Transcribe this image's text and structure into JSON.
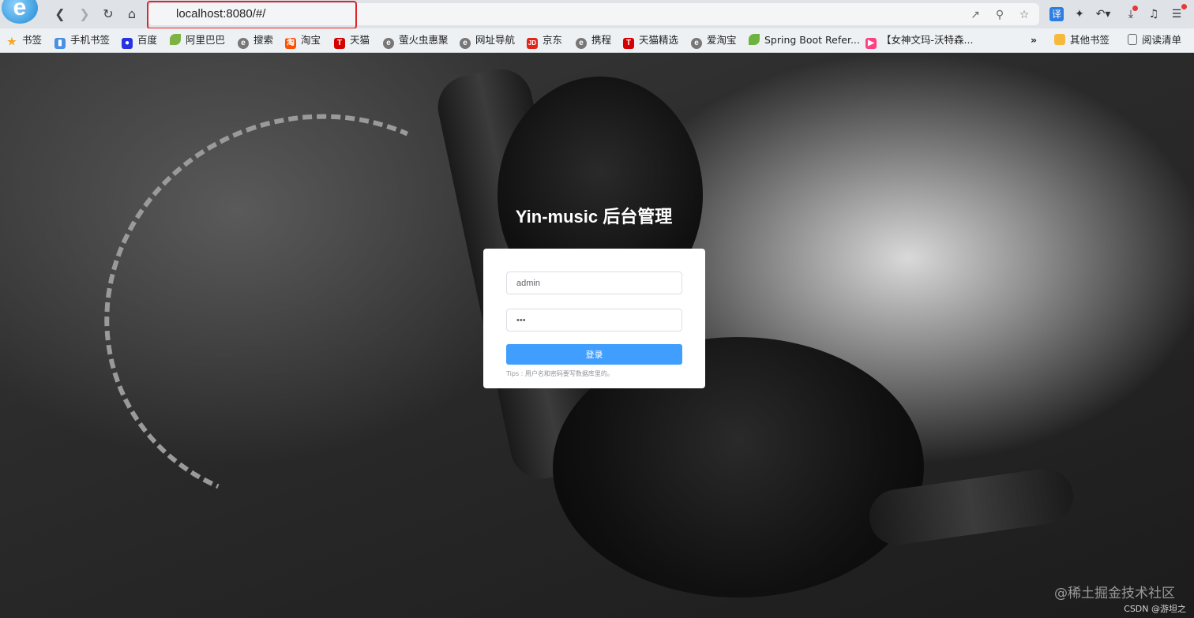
{
  "browser": {
    "address": "localhost:8080/#/",
    "translate_label": "译",
    "bookmarks": [
      {
        "label": "书签",
        "icon": "star-icon",
        "color": "#f5a623"
      },
      {
        "label": "手机书签",
        "icon": "phone-icon",
        "color": "#4a90e2"
      },
      {
        "label": "百度",
        "icon": "baidu-icon",
        "color": "#2932e1"
      },
      {
        "label": "阿里巴巴",
        "icon": "leaf-icon",
        "color": "#7cb342"
      },
      {
        "label": "搜索",
        "icon": "e-icon",
        "color": "#666666"
      },
      {
        "label": "淘宝",
        "icon": "taobao-icon",
        "color": "#ff5000"
      },
      {
        "label": "天猫",
        "icon": "tmall-icon",
        "color": "#d50000"
      },
      {
        "label": "萤火虫惠聚",
        "icon": "e-icon",
        "color": "#666666"
      },
      {
        "label": "网址导航",
        "icon": "e-icon",
        "color": "#666666"
      },
      {
        "label": "京东",
        "icon": "jd-icon",
        "color": "#e1251b"
      },
      {
        "label": "携程",
        "icon": "e-icon",
        "color": "#666666"
      },
      {
        "label": "天猫精选",
        "icon": "tmall-icon",
        "color": "#d50000"
      },
      {
        "label": "爱淘宝",
        "icon": "e-icon",
        "color": "#666666"
      },
      {
        "label": "Spring Boot Refer...",
        "icon": "spring-icon",
        "color": "#6db33f"
      },
      {
        "label": "【女神文玛-沃特森...",
        "icon": "video-icon",
        "color": "#ff4081"
      }
    ],
    "more_label": "»",
    "other_bookmarks": "其他书签",
    "reading_list": "阅读清单"
  },
  "login": {
    "title": "Yin-music 后台管理",
    "username": "admin",
    "password": "123",
    "button_label": "登录",
    "tips": "Tips : 用户名和密码要写数据库里的。"
  },
  "watermark": "@稀土掘金技术社区",
  "watermark_small": "CSDN @游坦之"
}
